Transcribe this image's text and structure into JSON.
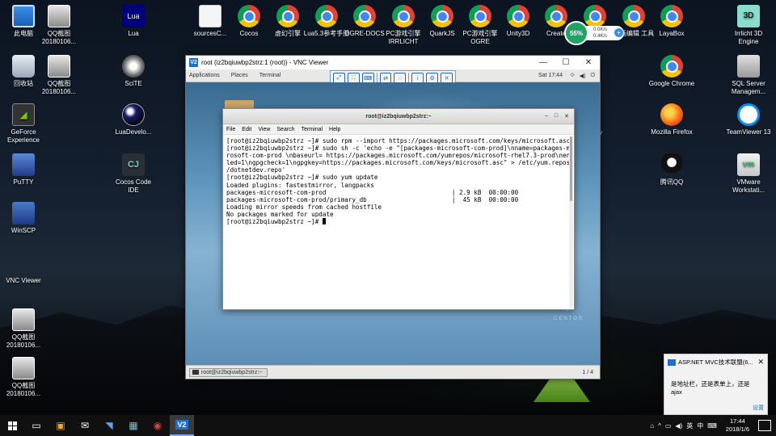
{
  "desktop": {
    "icons_left": [
      {
        "label": "此电脑",
        "icon": "pc-icon"
      },
      {
        "label": "回收站",
        "icon": "recycle-bin-icon"
      },
      {
        "label": "GeForce Experience",
        "icon": "geforce-icon"
      },
      {
        "label": "PuTTY",
        "icon": "putty-icon"
      },
      {
        "label": "WinSCP",
        "icon": "winscp-icon"
      },
      {
        "label": "VNC Viewer",
        "icon": "vnc-icon"
      },
      {
        "label": "QQ截图 20180106...",
        "icon": "screenshot-icon"
      },
      {
        "label": "QQ截图 20180106...",
        "icon": "screenshot-icon"
      }
    ],
    "icons_col2": [
      {
        "label": "QQ截图 20180106...",
        "icon": "screenshot-icon"
      },
      {
        "label": "QQ截图 20180106...",
        "icon": "screenshot-icon"
      }
    ],
    "icons_col3": [
      {
        "label": "Lua",
        "icon": "lua-icon"
      },
      {
        "label": "SciTE",
        "icon": "scite-icon"
      },
      {
        "label": "LuaDevelo...",
        "icon": "luadev-icon"
      },
      {
        "label": "Cocos Code IDE",
        "icon": "cocos-icon"
      }
    ],
    "icons_top": [
      {
        "label": "sourcesC...",
        "icon": "document-icon"
      },
      {
        "label": "Cocos",
        "icon": "chrome-icon"
      },
      {
        "label": "虚幻引擎",
        "icon": "chrome-icon"
      },
      {
        "label": "Lua5.3参考手册",
        "icon": "chrome-icon"
      },
      {
        "label": "OGRE-DOCS",
        "icon": "chrome-icon"
      },
      {
        "label": "PC游戏引擎 IRRLICHT",
        "icon": "chrome-icon"
      },
      {
        "label": "QuarkJS",
        "icon": "chrome-icon"
      },
      {
        "label": "PC游戏引擎 OGRE",
        "icon": "chrome-icon"
      },
      {
        "label": "Unity3D",
        "icon": "chrome-icon"
      },
      {
        "label": "Create",
        "icon": "chrome-icon"
      },
      {
        "label": "",
        "icon": "chrome-icon"
      },
      {
        "label": "动画编辑 工具",
        "icon": "chrome-icon"
      },
      {
        "label": "LayaBox",
        "icon": "chrome-icon"
      }
    ],
    "icons_right1": [
      {
        "label": "Google Chrome",
        "icon": "chrome-icon"
      },
      {
        "label": "Mozilla Firefox",
        "icon": "firefox-icon"
      },
      {
        "label": "腾讯QQ",
        "icon": "qq-penguin-icon"
      }
    ],
    "icons_right2": [
      {
        "label": "Irrlicht 3D Engine",
        "icon": "irrlicht-icon"
      },
      {
        "label": "SQL Server Managem...",
        "icon": "sql-server-icon"
      },
      {
        "label": "TeamViewer 13",
        "icon": "teamviewer-icon"
      },
      {
        "label": "VMware Workstati...",
        "icon": "vmware-icon"
      }
    ],
    "partial_labels": [
      "mes",
      "er",
      "y"
    ]
  },
  "network_widget": {
    "percent": "55%",
    "up": "0.0K/s",
    "down": "0.4K/s"
  },
  "vnc": {
    "title": "root (iz2bqiuwbp2strz:1 (root)) - VNC Viewer",
    "toolbar": [
      "fit",
      "fullscreen",
      "ctrl-alt-del",
      "transfer",
      "chat",
      "info",
      "settings",
      "close"
    ],
    "gnome_top": {
      "menus": [
        "Applications",
        "Places",
        "Terminal"
      ],
      "clock": "Sat 17:44"
    },
    "terminal": {
      "title": "root@iz2bqiuwbp2strz:~",
      "menu": [
        "File",
        "Edit",
        "View",
        "Search",
        "Terminal",
        "Help"
      ],
      "lines": [
        "[root@iz2bqiuwbp2strz ~]# sudo rpm --import https://packages.microsoft.com/keys/microsoft.asc",
        "[root@iz2bqiuwbp2strz ~]# sudo sh -c 'echo -e \"[packages-microsoft-com-prod]\\nname=packages-mic",
        "rosoft-com-prod \\nbaseurl= https://packages.microsoft.com/yumrepos/microsoft-rhel7.3-prod\\nenab",
        "led=1\\ngpgcheck=1\\ngpgkey=https://packages.microsoft.com/keys/microsoft.asc\" > /etc/yum.repos.d",
        "/dotnetdev.repo'",
        "[root@iz2bqiuwbp2strz ~]# sudo yum update",
        "Loaded plugins: fastestmirror, langpacks",
        "packages-microsoft-com-prod                                  | 2.9 kB  00:00:00",
        "packages-microsoft-com-prod/primary_db                       |  45 kB  00:00:00",
        "Loading mirror speeds from cached hostfile",
        "No packages marked for update"
      ],
      "prompt": "[root@iz2bqiuwbp2strz ~]# "
    },
    "centos_brand": {
      "version": "7",
      "name": "CENTOS"
    },
    "gnome_bottom": {
      "task": "root@iz2bqiuwbp2strz:~",
      "pager": "1 / 4"
    }
  },
  "notification": {
    "title": "ASP.NET MVC技术联盟(6...",
    "message": "是地址栏，还是表单上，还是ajax",
    "settings": "设置"
  },
  "taskbar": {
    "time": "17:44",
    "date": "2018/1/6",
    "ime": "英",
    "tray_extra": "中"
  }
}
